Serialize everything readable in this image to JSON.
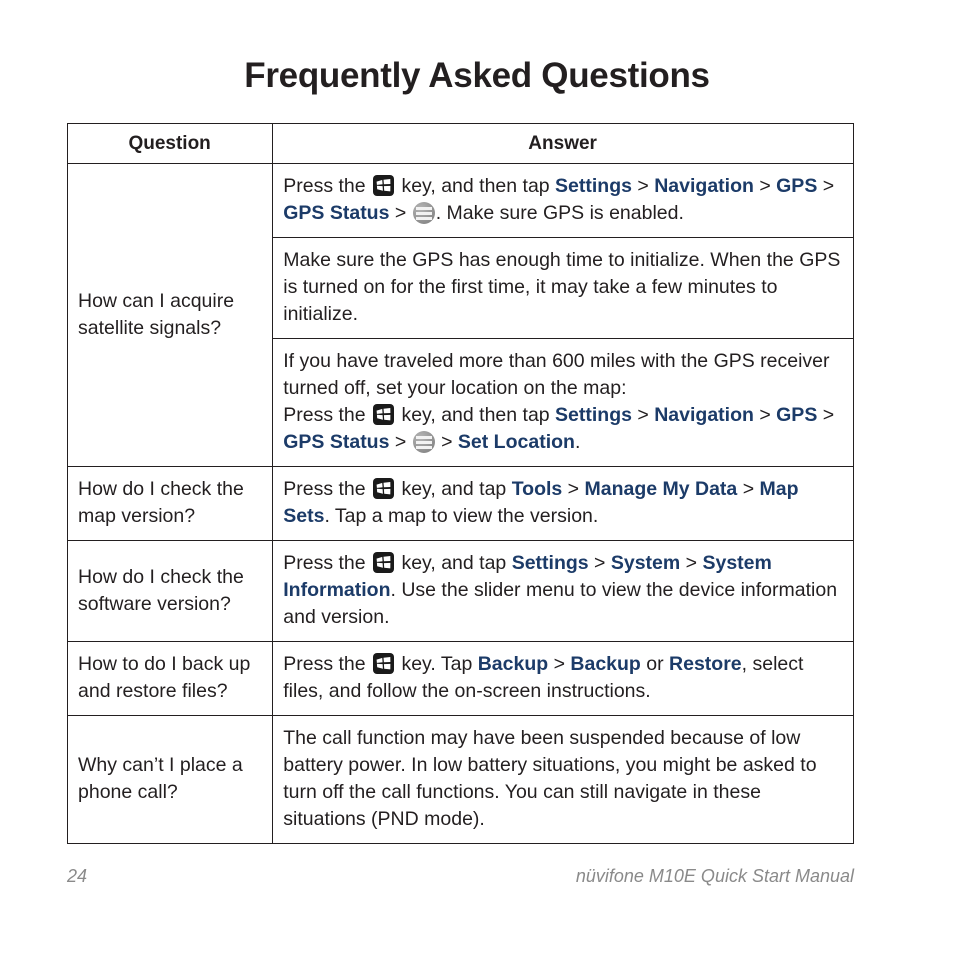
{
  "page_title": "Frequently Asked Questions",
  "colors": {
    "nav_link": "#1c3b68",
    "body_text": "#231f20",
    "footer_text": "#8a8a8a",
    "win_icon_bg": "#1a1a1a",
    "menu_icon_bg": "#8c8c8c"
  },
  "table": {
    "headers": {
      "question": "Question",
      "answer": "Answer"
    },
    "rows": [
      {
        "question": "How can I acquire satellite signals?",
        "answers": [
          {
            "id": "answer-gps-enable",
            "parts": [
              {
                "type": "text",
                "value": "Press the "
              },
              {
                "type": "icon",
                "icon": "windows-key-icon"
              },
              {
                "type": "text",
                "value": " key, and then tap "
              },
              {
                "type": "nav",
                "value": "Settings"
              },
              {
                "type": "sep",
                "value": " > "
              },
              {
                "type": "nav",
                "value": "Navigation"
              },
              {
                "type": "sep",
                "value": " > "
              },
              {
                "type": "nav",
                "value": "GPS"
              },
              {
                "type": "sep",
                "value": " > "
              },
              {
                "type": "nav",
                "value": "GPS Status"
              },
              {
                "type": "sep",
                "value": " > "
              },
              {
                "type": "icon",
                "icon": "menu-icon"
              },
              {
                "type": "text",
                "value": ". Make sure GPS is enabled."
              }
            ]
          },
          {
            "id": "answer-gps-initialize",
            "parts": [
              {
                "type": "text",
                "value": "Make sure the GPS has enough time to initialize. When the GPS is turned on for the first time, it may take a few minutes to initialize."
              }
            ]
          },
          {
            "id": "answer-gps-set-location",
            "parts": [
              {
                "type": "text",
                "value": "If you have traveled more than 600 miles with the GPS receiver turned off, set your location on the map:"
              },
              {
                "type": "break"
              },
              {
                "type": "text",
                "value": "Press the "
              },
              {
                "type": "icon",
                "icon": "windows-key-icon"
              },
              {
                "type": "text",
                "value": " key, and then tap "
              },
              {
                "type": "nav",
                "value": "Settings"
              },
              {
                "type": "sep",
                "value": " > "
              },
              {
                "type": "nav",
                "value": "Navigation"
              },
              {
                "type": "sep",
                "value": " > "
              },
              {
                "type": "nav",
                "value": "GPS"
              },
              {
                "type": "sep",
                "value": " > "
              },
              {
                "type": "nav",
                "value": "GPS Status"
              },
              {
                "type": "sep",
                "value": " > "
              },
              {
                "type": "icon",
                "icon": "menu-icon"
              },
              {
                "type": "sep",
                "value": " > "
              },
              {
                "type": "nav",
                "value": "Set Location"
              },
              {
                "type": "text",
                "value": "."
              }
            ]
          }
        ]
      },
      {
        "question": "How do I check the map version?",
        "answers": [
          {
            "id": "answer-map-version",
            "parts": [
              {
                "type": "text",
                "value": "Press the "
              },
              {
                "type": "icon",
                "icon": "windows-key-icon"
              },
              {
                "type": "text",
                "value": " key, and tap "
              },
              {
                "type": "nav",
                "value": "Tools"
              },
              {
                "type": "sep",
                "value": " > "
              },
              {
                "type": "nav",
                "value": "Manage My Data"
              },
              {
                "type": "sep",
                "value": " > "
              },
              {
                "type": "nav",
                "value": "Map Sets"
              },
              {
                "type": "text",
                "value": ". Tap a map to view the version."
              }
            ]
          }
        ]
      },
      {
        "question": "How do I check the software version?",
        "answers": [
          {
            "id": "answer-software-version",
            "parts": [
              {
                "type": "text",
                "value": "Press the "
              },
              {
                "type": "icon",
                "icon": "windows-key-icon"
              },
              {
                "type": "text",
                "value": " key, and tap "
              },
              {
                "type": "nav",
                "value": "Settings"
              },
              {
                "type": "sep",
                "value": " > "
              },
              {
                "type": "nav",
                "value": "System"
              },
              {
                "type": "sep",
                "value": " > "
              },
              {
                "type": "nav",
                "value": "System Information"
              },
              {
                "type": "text",
                "value": ". Use the slider menu to view the device information and version."
              }
            ]
          }
        ]
      },
      {
        "question": "How to do I back up and restore files?",
        "answers": [
          {
            "id": "answer-backup-restore",
            "parts": [
              {
                "type": "text",
                "value": "Press the "
              },
              {
                "type": "icon",
                "icon": "windows-key-icon"
              },
              {
                "type": "text",
                "value": " key. Tap "
              },
              {
                "type": "nav",
                "value": "Backup"
              },
              {
                "type": "sep",
                "value": " > "
              },
              {
                "type": "nav",
                "value": "Backup"
              },
              {
                "type": "text",
                "value": " or "
              },
              {
                "type": "nav",
                "value": "Restore"
              },
              {
                "type": "text",
                "value": ", select files, and follow the on-screen instructions."
              }
            ]
          }
        ]
      },
      {
        "question": "Why can’t I place a phone call?",
        "answers": [
          {
            "id": "answer-phone-call",
            "parts": [
              {
                "type": "text",
                "value": "The call function may have been suspended because of low battery power. In low battery situations, you might be asked to turn off the call functions. You can still navigate in these situations (PND mode)."
              }
            ]
          }
        ]
      }
    ]
  },
  "footer": {
    "page_number": "24",
    "manual_title": "nüvifone M10E Quick Start Manual"
  }
}
